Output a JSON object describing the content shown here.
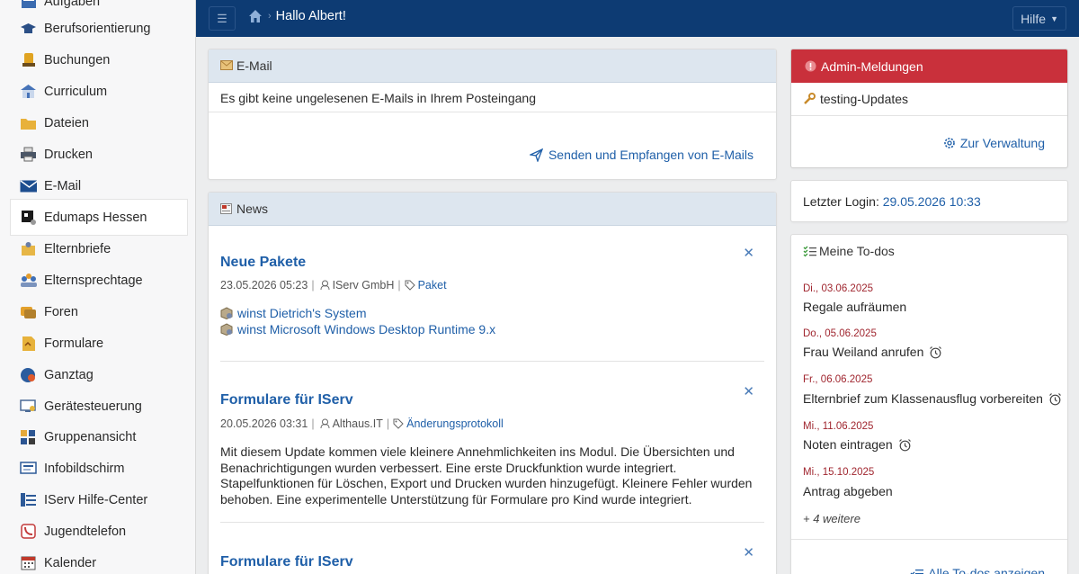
{
  "sidebar": {
    "items": [
      {
        "label": "Aufgaben",
        "icon": "tasks-icon"
      },
      {
        "label": "Berufsorientierung",
        "icon": "graduation-cap-icon"
      },
      {
        "label": "Buchungen",
        "icon": "booking-icon"
      },
      {
        "label": "Curriculum",
        "icon": "school-icon"
      },
      {
        "label": "Dateien",
        "icon": "folder-icon"
      },
      {
        "label": "Drucken",
        "icon": "printer-icon"
      },
      {
        "label": "E-Mail",
        "icon": "envelope-icon"
      },
      {
        "label": "Edumaps Hessen",
        "icon": "edumaps-icon"
      },
      {
        "label": "Elternbriefe",
        "icon": "parent-letter-icon"
      },
      {
        "label": "Elternsprechtage",
        "icon": "people-icon"
      },
      {
        "label": "Foren",
        "icon": "forum-icon"
      },
      {
        "label": "Formulare",
        "icon": "form-icon"
      },
      {
        "label": "Ganztag",
        "icon": "clock-globe-icon"
      },
      {
        "label": "Gerätesteuerung",
        "icon": "device-control-icon"
      },
      {
        "label": "Gruppenansicht",
        "icon": "group-grid-icon"
      },
      {
        "label": "Infobildschirm",
        "icon": "info-screen-icon"
      },
      {
        "label": "IServ Hilfe-Center",
        "icon": "help-center-icon"
      },
      {
        "label": "Jugendtelefon",
        "icon": "phone-icon"
      },
      {
        "label": "Kalender",
        "icon": "calendar-icon"
      }
    ]
  },
  "topbar": {
    "greeting": "Hallo Albert!",
    "help_label": "Hilfe"
  },
  "email": {
    "title": "E-Mail",
    "message": "Es gibt keine ungelesenen E-Mails in Ihrem Posteingang",
    "link": "Senden und Empfangen von E-Mails"
  },
  "news": {
    "title": "News",
    "items": [
      {
        "title": "Neue Pakete",
        "date": "23.05.2026 05:23",
        "author": "IServ GmbH",
        "tag": "Paket",
        "packages": [
          "winst Dietrich's System",
          "winst Microsoft Windows Desktop Runtime 9.x"
        ]
      },
      {
        "title": "Formulare für IServ",
        "date": "20.05.2026 03:31",
        "author": "Althaus.IT",
        "tag": "Änderungsprotokoll",
        "body": "Mit diesem Update kommen viele kleinere Annehmlichkeiten ins Modul. Die Übersichten und Benachrichtigungen wurden verbessert. Eine erste Druckfunktion wurde integriert. Stapelfunktionen für Löschen, Export und Drucken wurden hinzugefügt. Kleinere Fehler wurden behoben. Eine experimentelle Unterstützung für Formulare pro Kind wurde integriert."
      },
      {
        "title": "Formulare für IServ"
      }
    ]
  },
  "admin": {
    "title": "Admin-Meldungen",
    "item": "testing-Updates",
    "link": "Zur Verwaltung"
  },
  "login": {
    "label": "Letzter Login:",
    "value": "29.05.2026 10:33"
  },
  "todos": {
    "title": "Meine To-dos",
    "items": [
      {
        "date": "Di., 03.06.2025",
        "text": "Regale aufräumen",
        "alarm": false
      },
      {
        "date": "Do., 05.06.2025",
        "text": "Frau Weiland anrufen",
        "alarm": true
      },
      {
        "date": "Fr., 06.06.2025",
        "text": "Elternbrief zum Klassenausflug vorbereiten",
        "alarm": true
      },
      {
        "date": "Mi., 11.06.2025",
        "text": "Noten eintragen",
        "alarm": true
      },
      {
        "date": "Mi., 15.10.2025",
        "text": "Antrag abgeben",
        "alarm": false
      }
    ],
    "more": "+ 4 weitere",
    "all_link": "Alle To-dos anzeigen"
  },
  "colors": {
    "topbar": "#0d3b73",
    "link": "#1f5fa8",
    "admin_header": "#c9303b",
    "todo_date": "#a0262f",
    "panel_header": "#dde6ef"
  }
}
